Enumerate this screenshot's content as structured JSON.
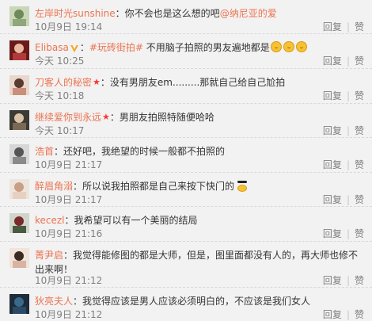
{
  "actions": {
    "reply": "回复",
    "like": "赞"
  },
  "comments": [
    {
      "name": "左岸时光sunshine",
      "sep": "：",
      "text": "你不会也是这么想的吧",
      "mention": "@纳尼亚的爱",
      "time": "10月9日 19:14",
      "avatar_icon": "avatar-photo"
    },
    {
      "name": "Elibasa",
      "sep": "：",
      "tag": "#玩砖街拍#",
      "text": " 不用脑子拍照的男友遍地都是",
      "time": "今天 10:25",
      "badge": "vip-v-icon",
      "avatar_icon": "avatar-photo"
    },
    {
      "name": "刀客人的秘密",
      "sep": "：",
      "text": "没有男朋友em.........那就自己给自己尬拍",
      "time": "今天 10:18",
      "badge": "star-icon",
      "avatar_icon": "avatar-photo"
    },
    {
      "name": "继续爱你到永远",
      "sep": "：",
      "text": "男朋友拍照特随便哈哈",
      "time": "今天 10:17",
      "badge": "star-icon",
      "avatar_icon": "avatar-photo"
    },
    {
      "name": "浩首",
      "sep": "：",
      "text": "还好吧，我绝望的时候一般都不拍照的",
      "time": "10月9日 21:17",
      "avatar_icon": "avatar-photo"
    },
    {
      "name": "醉眉角溺",
      "sep": "：",
      "text": "所以说我拍照都是自己来按下快门的",
      "time": "10月9日 21:17",
      "avatar_icon": "avatar-photo"
    },
    {
      "name": "kecezl",
      "sep": "：",
      "text": "我希望可以有一个美丽的结局",
      "time": "10月9日 21:16",
      "avatar_icon": "avatar-photo"
    },
    {
      "name": "菁尹启",
      "sep": "：",
      "text": "我觉得能修图的都是大师，但是，图里面都没有人的，再大师也修不出来啊！",
      "time": "10月9日 21:12",
      "avatar_icon": "avatar-photo"
    },
    {
      "name": "狄亮夫人",
      "sep": "：",
      "text": "我觉得应该是男人应该必须明白的，不应该是我们女人",
      "time": "10月9日 21:12",
      "avatar_icon": "avatar-photo"
    }
  ]
}
